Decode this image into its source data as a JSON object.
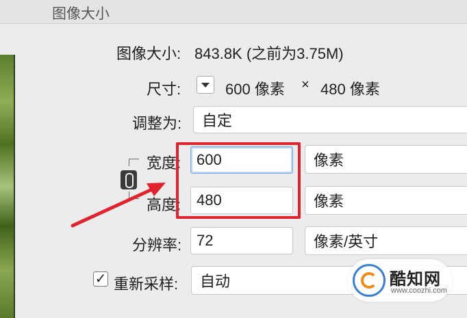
{
  "window": {
    "title": "图像大小"
  },
  "image_size": {
    "label": "图像大小:",
    "value": "843.8K (之前为3.75M)"
  },
  "dimensions": {
    "label": "尺寸:",
    "width": "600 像素",
    "times": "×",
    "height": "480 像素"
  },
  "fit_to": {
    "label": "调整为:",
    "value": "自定"
  },
  "width": {
    "label": "宽度:",
    "value": "600",
    "unit": "像素"
  },
  "height": {
    "label": "高度:",
    "value": "480",
    "unit": "像素"
  },
  "resolution": {
    "label": "分辨率:",
    "value": "72",
    "unit": "像素/英寸"
  },
  "resample": {
    "checkbox_mark": "✓",
    "label": "重新采样:",
    "value": "自动"
  },
  "watermark": {
    "name": "酷知网",
    "url": "www.coozhi.com"
  },
  "colors": {
    "highlight": "#e0242e",
    "focus": "#7aa6e2"
  }
}
